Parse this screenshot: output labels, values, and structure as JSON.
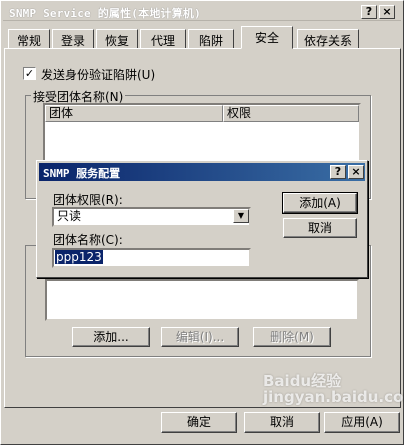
{
  "window": {
    "title": "SNMP Service 的属性(本地计算机)",
    "help_btn": "?",
    "close_btn": "×"
  },
  "tabs": [
    {
      "label": "常规"
    },
    {
      "label": "登录"
    },
    {
      "label": "恢复"
    },
    {
      "label": "代理"
    },
    {
      "label": "陷阱"
    },
    {
      "label": "安全",
      "active": true
    },
    {
      "label": "依存关系"
    }
  ],
  "security": {
    "send_auth_trap": "发送身份验证陷阱(U)",
    "send_auth_trap_checked": true,
    "accepted_communities_label": "接受团体名称(N)",
    "col_community": "团体",
    "col_rights": "权限",
    "add_btn": "添加...",
    "edit_btn": "编辑(I)...",
    "remove_btn": "删除(M)"
  },
  "dialog": {
    "title": "SNMP 服务配置",
    "help_btn": "?",
    "close_btn": "×",
    "rights_label": "团体权限(R):",
    "rights_value": "只读",
    "name_label": "团体名称(C):",
    "name_value": "ppp123",
    "add_btn": "添加(A)",
    "cancel_btn": "取消"
  },
  "footer": {
    "ok_btn": "确定",
    "cancel_btn": "取消",
    "apply_btn": "应用(A)"
  },
  "watermark": "Baidu经验 jingyan.baidu.com",
  "colors": {
    "face": "#d4d0c8",
    "title_active_start": "#0a246a",
    "title_active_end": "#3a6ea5",
    "selection": "#0a246a"
  }
}
